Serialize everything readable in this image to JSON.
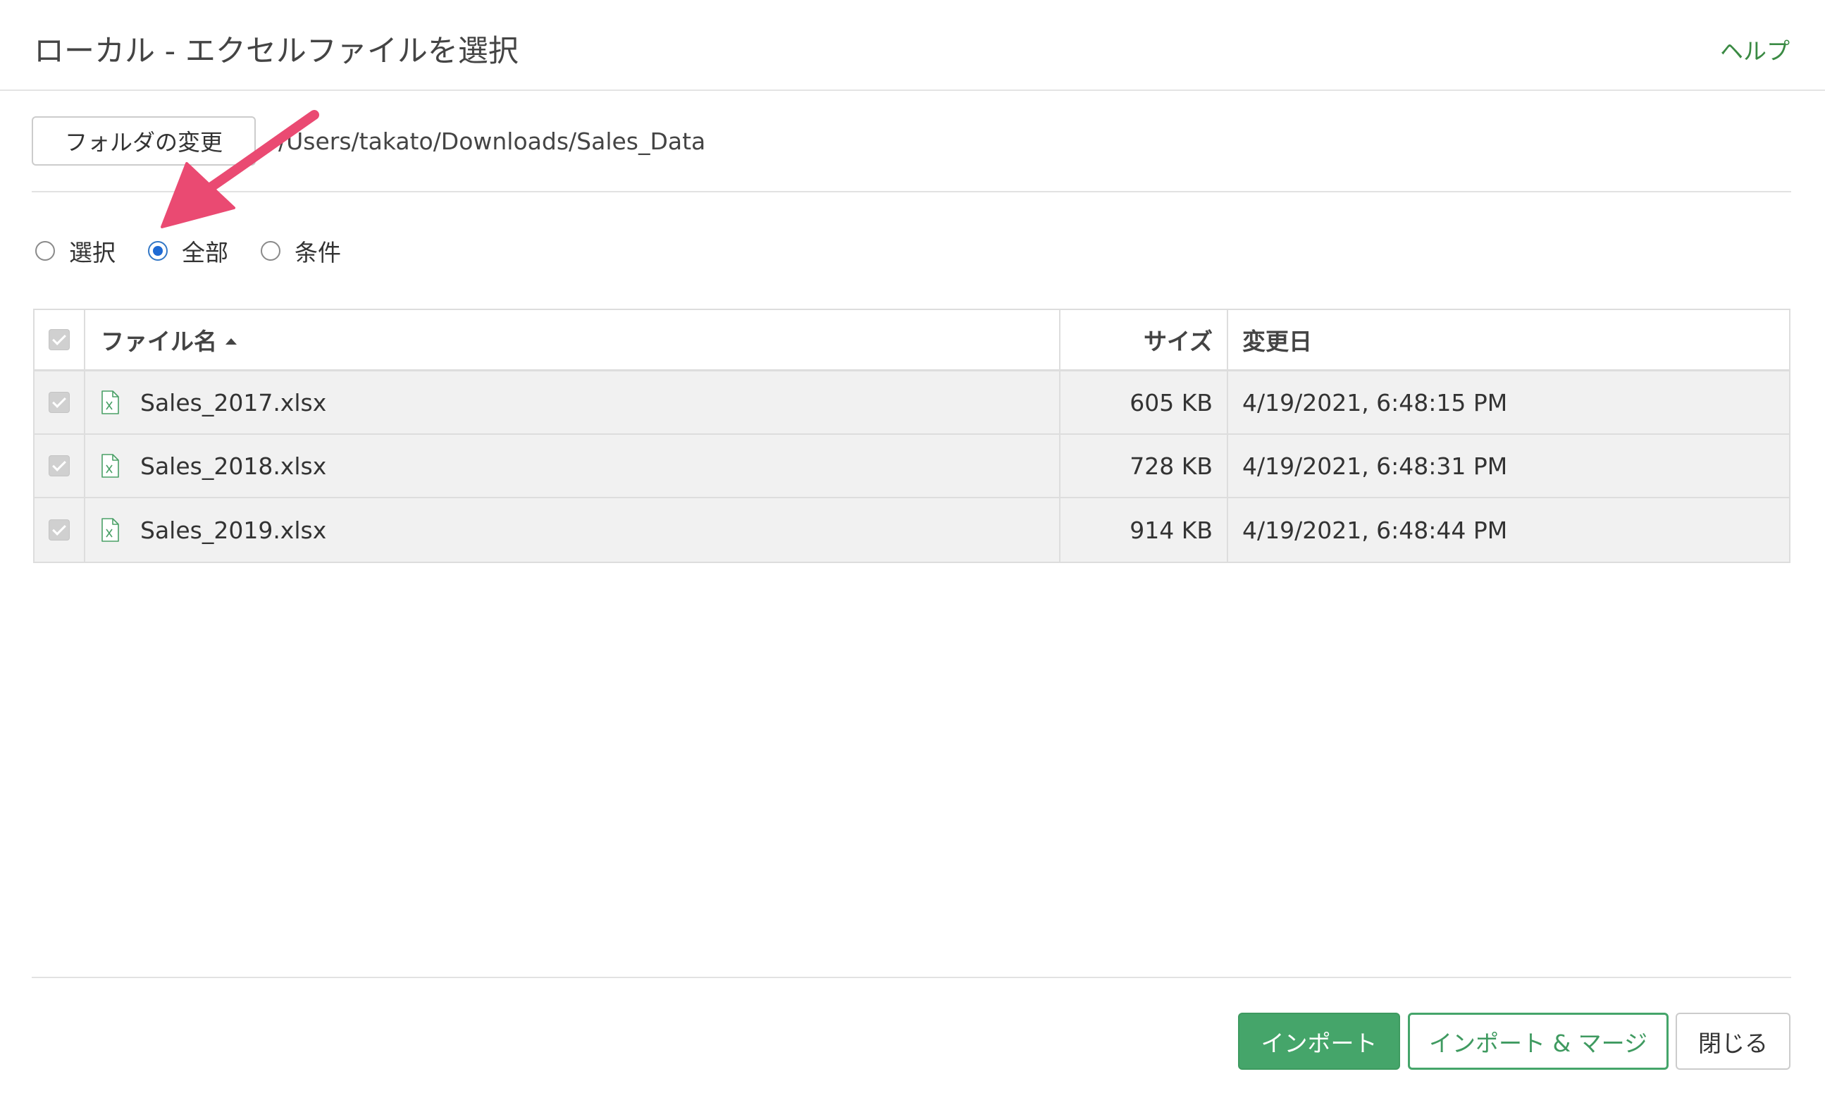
{
  "header": {
    "title": "ローカル - エクセルファイルを選択",
    "help_label": "ヘルプ"
  },
  "folder": {
    "change_button_label": "フォルダの変更",
    "path": "/Users/takato/Downloads/Sales_Data"
  },
  "selection_mode": {
    "options": [
      {
        "label": "選択",
        "checked": false
      },
      {
        "label": "全部",
        "checked": true
      },
      {
        "label": "条件",
        "checked": false
      }
    ]
  },
  "table": {
    "columns": {
      "name": "ファイル名",
      "size": "サイズ",
      "modified": "変更日"
    },
    "sort": {
      "column": "name",
      "direction": "ascending"
    },
    "rows": [
      {
        "name": "Sales_2017.xlsx",
        "size": "605 KB",
        "modified": "4/19/2021, 6:48:15 PM",
        "checked": true
      },
      {
        "name": "Sales_2018.xlsx",
        "size": "728 KB",
        "modified": "4/19/2021, 6:48:31 PM",
        "checked": true
      },
      {
        "name": "Sales_2019.xlsx",
        "size": "914 KB",
        "modified": "4/19/2021, 6:48:44 PM",
        "checked": true
      }
    ]
  },
  "footer": {
    "import_label": "インポート",
    "import_merge_label": "インポート & マージ",
    "close_label": "閉じる"
  },
  "colors": {
    "accent_green": "#45a56a",
    "radio_blue": "#1e6ad4",
    "annotation_arrow": "#ea4a72"
  },
  "icons": {
    "file": "excel-file-icon",
    "sort": "sort-ascending-icon",
    "annotation": "pink-arrow-annotation"
  }
}
